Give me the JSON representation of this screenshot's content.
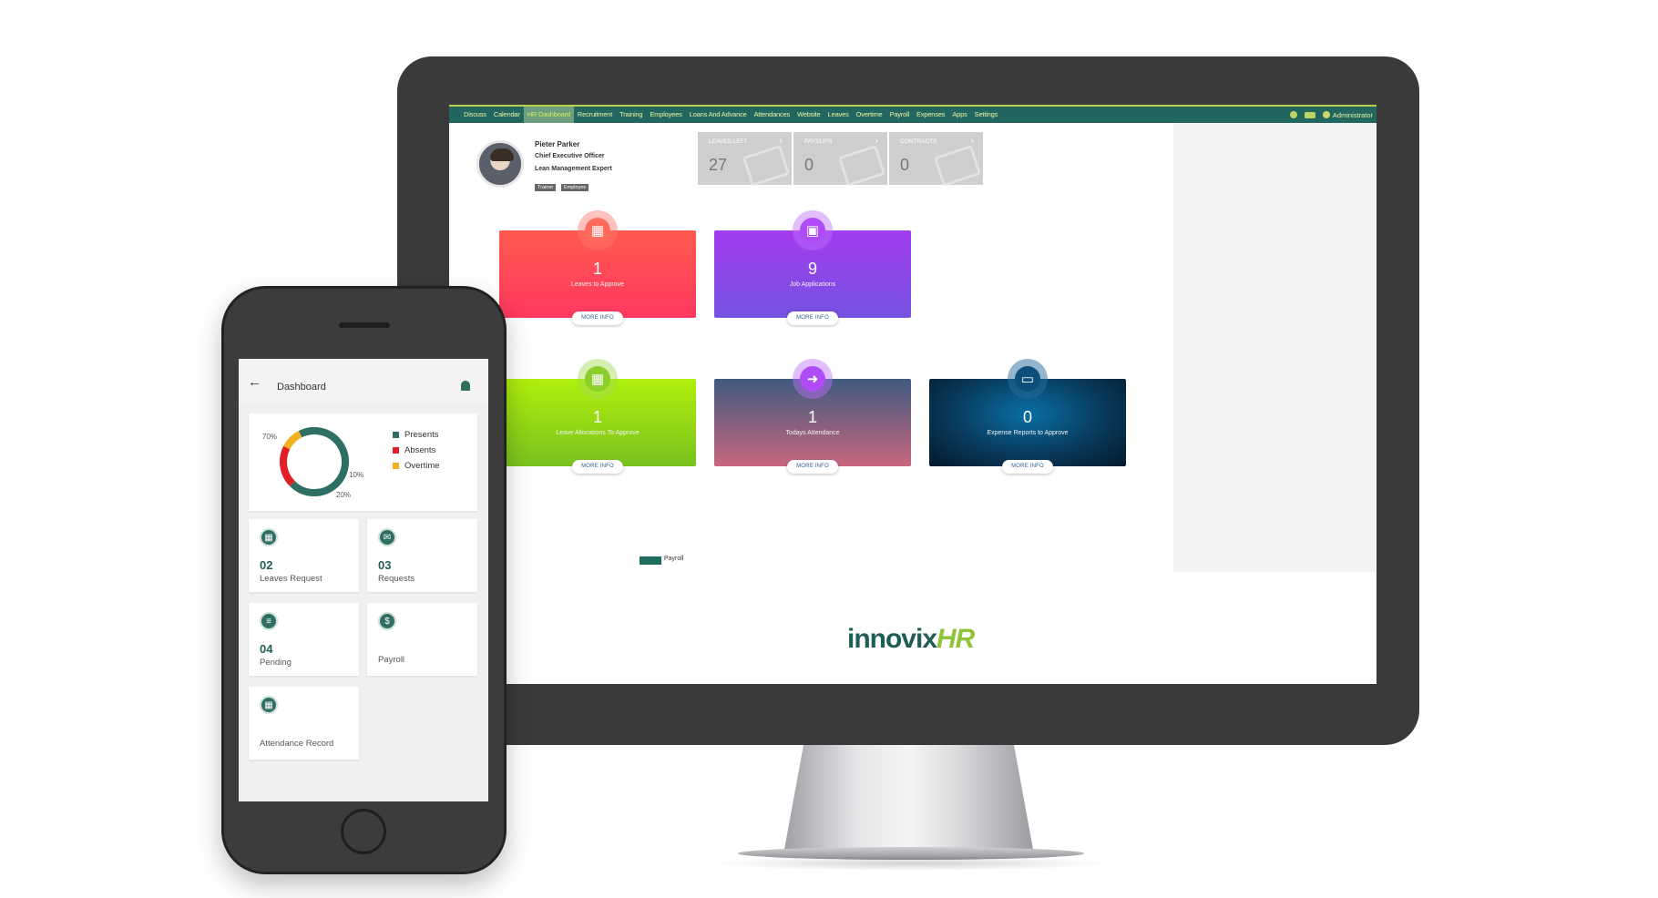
{
  "desktop": {
    "nav": {
      "items": [
        "Discuss",
        "Calendar",
        "HR Dashboard",
        "Recruitment",
        "Training",
        "Employees",
        "Loans And Advance",
        "Attendances",
        "Website",
        "Leaves",
        "Overtime",
        "Payroll",
        "Expenses",
        "Apps",
        "Settings"
      ],
      "active": "HR Dashboard",
      "user": "Administrator"
    },
    "profile": {
      "name": "Pieter Parker",
      "title": "Chief Executive Officer",
      "subtitle": "Lean Management Expert",
      "tags": [
        "Trainer",
        "Employee"
      ]
    },
    "stats": [
      {
        "label": "LEAVES LEFT",
        "value": "27"
      },
      {
        "label": "PAYSLIPS",
        "value": "0"
      },
      {
        "label": "CONTRACTS",
        "value": "0"
      }
    ],
    "tiles": [
      {
        "value": "1",
        "caption": "Leaves to Approve",
        "more": "MORE INFO",
        "icon": "calendar-icon"
      },
      {
        "value": "9",
        "caption": "Job Applications",
        "more": "MORE INFO",
        "icon": "briefcase-icon"
      },
      {
        "value": "1",
        "caption": "Leave Allocations To Approve",
        "more": "MORE INFO",
        "icon": "calendar-icon"
      },
      {
        "value": "1",
        "caption": "Todays Attendance",
        "more": "MORE INFO",
        "icon": "sign-in-icon"
      },
      {
        "value": "0",
        "caption": "Expense Reports to Approve",
        "more": "MORE INFO",
        "icon": "money-icon"
      }
    ],
    "legend": "Payroll",
    "brand": {
      "part1": "innovix",
      "part2": "HR"
    }
  },
  "mobile": {
    "title": "Dashboard",
    "chart_data": {
      "type": "pie",
      "series": [
        {
          "name": "Presents",
          "value": 70,
          "color": "#2e6f64"
        },
        {
          "name": "Absents",
          "value": 20,
          "color": "#e01f26"
        },
        {
          "name": "Overtime",
          "value": 10,
          "color": "#f2b01e"
        }
      ],
      "labels": [
        "70%",
        "10%",
        "20%"
      ]
    },
    "cards": [
      {
        "value": "02",
        "label": "Leaves Request",
        "icon": "calendar-icon"
      },
      {
        "value": "03",
        "label": "Requests",
        "icon": "mail-icon"
      },
      {
        "value": "04",
        "label": "Pending",
        "icon": "list-icon"
      },
      {
        "value": "",
        "label": "Payroll",
        "icon": "dollar-icon"
      },
      {
        "value": "",
        "label": "Attendance Record",
        "icon": "calendar-icon"
      }
    ]
  }
}
